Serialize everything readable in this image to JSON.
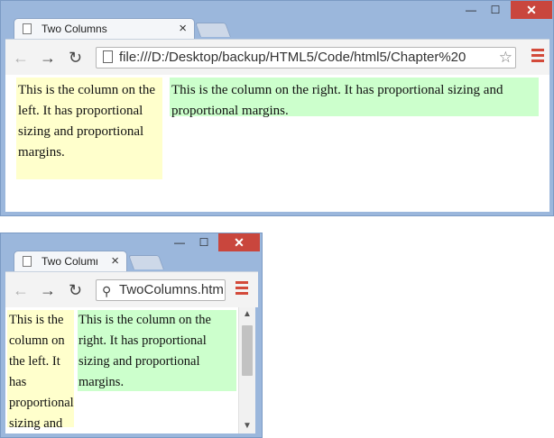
{
  "big_window": {
    "tab_title": "Two Columns",
    "tab_close": "×",
    "controls": {
      "minimize": "—",
      "maximize": "☐",
      "close": "✕"
    },
    "nav": {
      "back": "←",
      "forward": "→",
      "reload": "↻"
    },
    "address": "file:///D:/Desktop/backup/HTML5/Code/html5/Chapter%20",
    "star": "☆",
    "left_column": "This is the column on the left. It has proportional sizing and proportional margins.",
    "right_column": "This is the column on the right. It has proportional sizing and proportional margins."
  },
  "small_window": {
    "tab_title": "Two Columns",
    "tab_close": "×",
    "controls": {
      "minimize": "—",
      "maximize": "☐",
      "close": "✕"
    },
    "nav": {
      "back": "←",
      "forward": "→",
      "reload": "↻"
    },
    "address": "TwoColumns.htm",
    "search_glyph": "⚲",
    "left_column": "This is the column on the left. It has proportional sizing and proportional margins.",
    "right_column": "This is the column on the right. It has proportional sizing and proportional margins.",
    "scroll_up": "▲",
    "scroll_down": "▼"
  },
  "colors": {
    "left_column_bg": "#ffffcc",
    "right_column_bg": "#ccffcc",
    "close_button": "#c9463d",
    "menu_icon": "#d34a3a"
  }
}
